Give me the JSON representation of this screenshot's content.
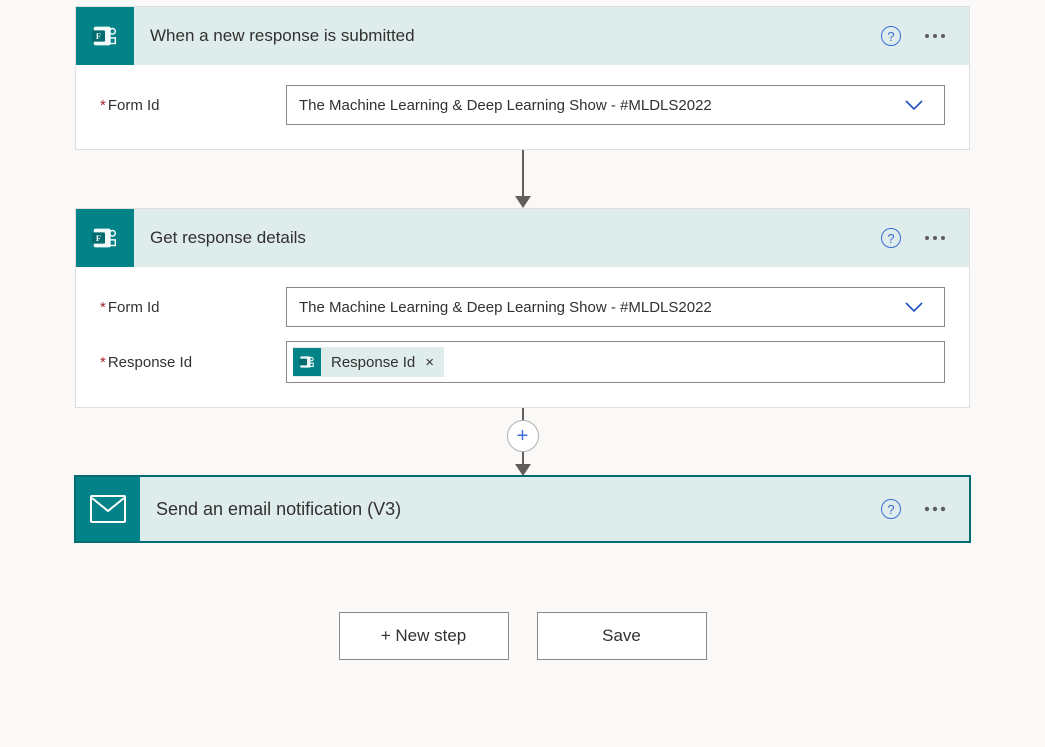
{
  "steps": {
    "trigger": {
      "title": "When a new response is submitted",
      "fields": {
        "form_id_label": "Form Id",
        "form_id_value": "The Machine Learning & Deep Learning Show - #MLDLS2022"
      }
    },
    "get_details": {
      "title": "Get response details",
      "fields": {
        "form_id_label": "Form Id",
        "form_id_value": "The Machine Learning & Deep Learning Show - #MLDLS2022",
        "response_id_label": "Response Id",
        "response_id_token": "Response Id"
      }
    },
    "send_email": {
      "title": "Send an email notification (V3)"
    }
  },
  "buttons": {
    "new_step": "+ New step",
    "save": "Save"
  },
  "glyphs": {
    "help": "?",
    "remove": "×",
    "plus": "+"
  }
}
